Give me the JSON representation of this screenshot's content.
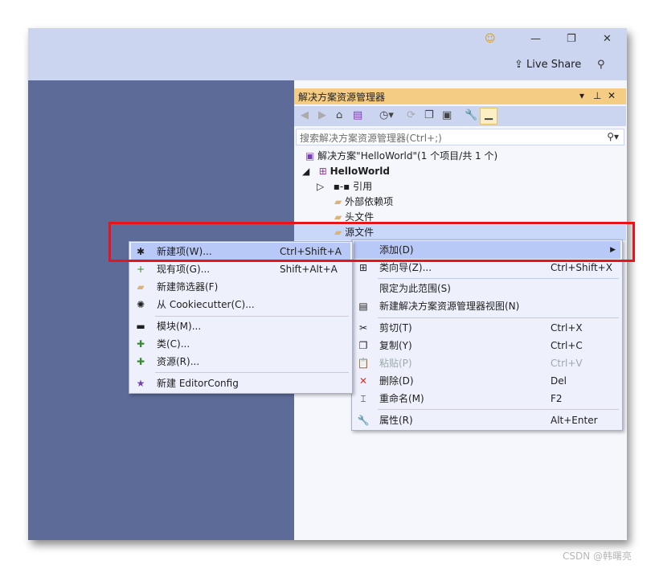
{
  "titlebar": {
    "live_share": "Live Share"
  },
  "panel": {
    "title": "解决方案资源管理器",
    "search_placeholder": "搜索解决方案资源管理器(Ctrl+;)",
    "tree": [
      {
        "label": "解决方案\"HelloWorld\"(1 个项目/共 1 个)"
      },
      {
        "label": "HelloWorld"
      },
      {
        "label": "引用"
      },
      {
        "label": "外部依赖项"
      },
      {
        "label": "头文件"
      },
      {
        "label": "源文件"
      }
    ]
  },
  "context_menu": {
    "items": [
      {
        "label": "添加(D)",
        "shortcut": ""
      },
      {
        "label": "类向导(Z)...",
        "shortcut": "Ctrl+Shift+X"
      },
      {
        "label": "限定为此范围(S)",
        "shortcut": ""
      },
      {
        "label": "新建解决方案资源管理器视图(N)",
        "shortcut": ""
      },
      {
        "label": "剪切(T)",
        "shortcut": "Ctrl+X"
      },
      {
        "label": "复制(Y)",
        "shortcut": "Ctrl+C"
      },
      {
        "label": "粘贴(P)",
        "shortcut": "Ctrl+V"
      },
      {
        "label": "删除(D)",
        "shortcut": "Del"
      },
      {
        "label": "重命名(M)",
        "shortcut": "F2"
      },
      {
        "label": "属性(R)",
        "shortcut": "Alt+Enter"
      }
    ]
  },
  "submenu": {
    "items": [
      {
        "label": "新建项(W)...",
        "shortcut": "Ctrl+Shift+A"
      },
      {
        "label": "现有项(G)...",
        "shortcut": "Shift+Alt+A"
      },
      {
        "label": "新建筛选器(F)",
        "shortcut": ""
      },
      {
        "label": "从 Cookiecutter(C)...",
        "shortcut": ""
      },
      {
        "label": "模块(M)...",
        "shortcut": ""
      },
      {
        "label": "类(C)...",
        "shortcut": ""
      },
      {
        "label": "资源(R)...",
        "shortcut": ""
      },
      {
        "label": "新建 EditorConfig",
        "shortcut": ""
      }
    ]
  },
  "watermark": "CSDN @韩曙亮",
  "colors": {
    "accent": "#f5cc84",
    "highlight": "#b9c9f7",
    "annotation": "#e8141a"
  }
}
